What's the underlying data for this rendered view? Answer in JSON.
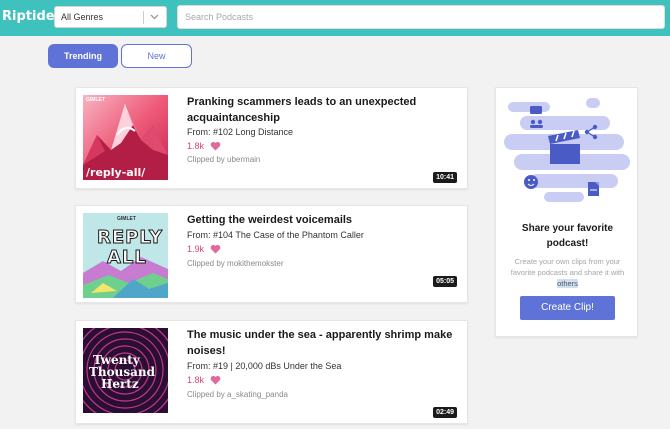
{
  "header": {
    "logo": "Riptide",
    "genre_selected": "All Genres",
    "search_placeholder": "Search Podcasts"
  },
  "tabs": [
    {
      "label": "Trending",
      "active": true
    },
    {
      "label": "New",
      "active": false
    }
  ],
  "clips": [
    {
      "title": "Pranking scammers leads to an unexpected acquaintanceship",
      "from": "From: #102 Long Distance",
      "likes": "1.8k",
      "clipped_by": "Clipped by ubermain",
      "duration": "10:41",
      "cover": {
        "podcast": "reply all",
        "brand": "GIMLET",
        "text": "/reply-all/"
      }
    },
    {
      "title": "Getting the weirdest voicemails",
      "from": "From: #104 The Case of the Phantom Caller",
      "likes": "1.9k",
      "clipped_by": "Clipped by mokithemokster",
      "duration": "05:05",
      "cover": {
        "podcast": "reply all",
        "brand": "GIMLET",
        "line1": "REPLY",
        "line2": "ALL"
      }
    },
    {
      "title": "The music under the sea - apparently shrimp make noises!",
      "from": "From: #19 | 20,000 dBs Under the Sea",
      "likes": "1.8k",
      "clipped_by": "Clipped by a_skating_panda",
      "duration": "02:49",
      "cover": {
        "podcast": "twenty thousand hertz",
        "line1": "Twenty",
        "line2": "Thousand",
        "line3": "Hertz"
      }
    }
  ],
  "sidebar": {
    "title": "Share your favorite podcast!",
    "text_main": "Create your own clips from your favorite podcasts and share it with",
    "text_highlight": "others",
    "button": "Create Clip!"
  },
  "colors": {
    "header": "#3fc1bd",
    "accent": "#5f72d8",
    "likes": "#d0467e",
    "heart": "#e06a9b"
  }
}
